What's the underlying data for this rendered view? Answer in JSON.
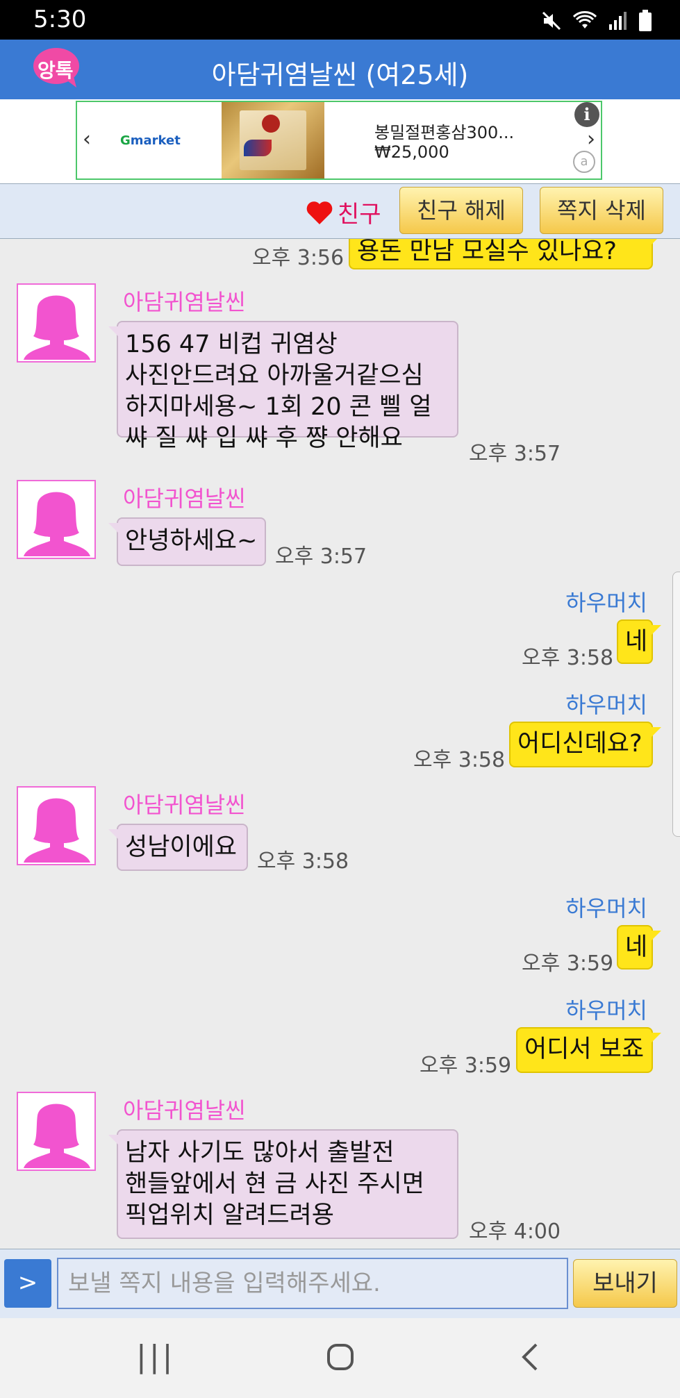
{
  "status": {
    "time": "5:30"
  },
  "app": {
    "logo_text": "앙톡",
    "title": "아담귀염날씬 (여25세)"
  },
  "ad": {
    "brand_g": "G",
    "brand_rest": "market",
    "product_name": "봉밀절편홍삼300...",
    "price": "₩25,000",
    "info": "i",
    "adchoice": "a"
  },
  "friendbar": {
    "friend_label": "친구",
    "unfriend_button": "친구 해제",
    "delete_button": "쪽지 삭제"
  },
  "messages": [
    {
      "side": "right",
      "text": "용돈 만남 모실수 있나요?",
      "time": "오후 3:56"
    },
    {
      "side": "left",
      "name": "아담귀염날씬",
      "text": "156 47 비컵 귀염상\n사진안드려요 아까울거같으심\n하지마세용~ 1회 20 콘 삘 얼\n쌰 질 쌰 입 쌰 후 쨩 안해요",
      "time": "오후 3:57"
    },
    {
      "side": "left",
      "name": "아담귀염날씬",
      "text": "안녕하세요~",
      "time": "오후 3:57"
    },
    {
      "side": "right",
      "name": "하우머치",
      "text": "네",
      "time": "오후 3:58"
    },
    {
      "side": "right",
      "name": "하우머치",
      "text": "어디신데요?",
      "time": "오후 3:58"
    },
    {
      "side": "left",
      "name": "아담귀염날씬",
      "text": "성남이에요",
      "time": "오후 3:58"
    },
    {
      "side": "right",
      "name": "하우머치",
      "text": "네",
      "time": "오후 3:59"
    },
    {
      "side": "right",
      "name": "하우머치",
      "text": "어디서 보죠",
      "time": "오후 3:59"
    },
    {
      "side": "left",
      "name": "아담귀염날씬",
      "text": "남자 사기도 많아서 출발전\n핸들앞에서 현   금 사진 주시면\n픽업위치 알려드려용",
      "time": "오후 4:00"
    }
  ],
  "input": {
    "go_label": ">",
    "placeholder": "보낼 쪽지 내용을 입력해주세요.",
    "send_label": "보내기"
  },
  "colors": {
    "header": "#3a7ad3",
    "female_name": "#f254cf",
    "male_name": "#3a7ad3",
    "left_bubble": "#ecd9ec",
    "right_bubble": "#ffe51a"
  },
  "navbar": {
    "recent": "|||",
    "home": "○",
    "back": "<"
  }
}
